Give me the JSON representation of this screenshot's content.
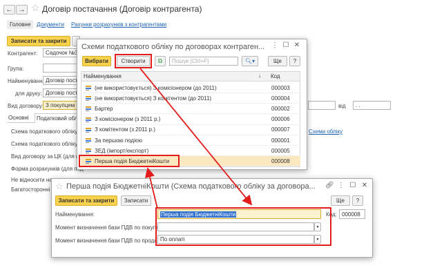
{
  "main_window": {
    "title": "Договір постачання (Договір контрагента)",
    "nav_tabs": [
      "Головне",
      "Документи",
      "Рахунки розрахунків з контрагентами"
    ],
    "save_close": "Записати та закрити",
    "fields": {
      "counterparty_label": "Контрагент:",
      "counterparty_value": "Садочок №3",
      "group_label": "Група:",
      "name_label": "Найменування:",
      "name_value": "Договір постач",
      "print_label": "для друку:",
      "print_value": "Договір постач",
      "kind_label": "Вид договору:",
      "kind_value": "З покупцем",
      "date_to_label": "від",
      "date_to_value": ". ."
    },
    "sub_tabs": [
      "Основні",
      "Податковий облік"
    ],
    "tax_section": [
      "Схема податкового обліку:",
      "Схема податкового обліку",
      "Вид договору за ЦК (для под",
      "Форма розрахунків (для под",
      "Не відносити на",
      "Багатосторонні"
    ],
    "tax_link": "Схеми обліку"
  },
  "schemes_dialog": {
    "title": "Схеми податкового обліку по договорах контраген...",
    "select_button": "Вибрати",
    "create_button": "Створити",
    "search_placeholder": "Пошук (Ctrl+F)",
    "more_button": "Ще",
    "help_button": "?",
    "columns": {
      "name": "Найменування",
      "code": "Код"
    },
    "rows": [
      {
        "name": "(не використовується) З комісіонером (до 2011)",
        "code": "000003"
      },
      {
        "name": "(не використовується) З комітентом (до 2011)",
        "code": "000004"
      },
      {
        "name": "Бартер",
        "code": "000002"
      },
      {
        "name": "З комісіонером (з 2011 р.)",
        "code": "000006"
      },
      {
        "name": "З комітентом (з 2011 р.)",
        "code": "000007"
      },
      {
        "name": "За першою подією",
        "code": "000001"
      },
      {
        "name": "ЗЕД (імпорт/експорт)",
        "code": "000005"
      },
      {
        "name": "Перша подія БюджетніКошти",
        "code": "000008"
      }
    ]
  },
  "scheme_form": {
    "title": "Перша подія БюджетніКошти (Схема податкового обліку за договора...",
    "save_close": "Записати та закрити",
    "save": "Записати",
    "more_button": "Ще",
    "help_button": "?",
    "name_label": "Найменування:",
    "name_value": "Перша подія БюджетніКошти",
    "code_label": "Код:",
    "code_value": "000008",
    "vat_purchase_label": "Момент визначення бази ПДВ по покупках:",
    "vat_purchase_value": "",
    "vat_sales_label": "Момент визначення бази ПДВ по продажах:",
    "vat_sales_value": "По оплаті"
  },
  "colors": {
    "accent_yellow": "#fbd24b",
    "highlight_red": "#e21b1b",
    "selected_row": "#fbe7c0",
    "link": "#1c63b4"
  }
}
